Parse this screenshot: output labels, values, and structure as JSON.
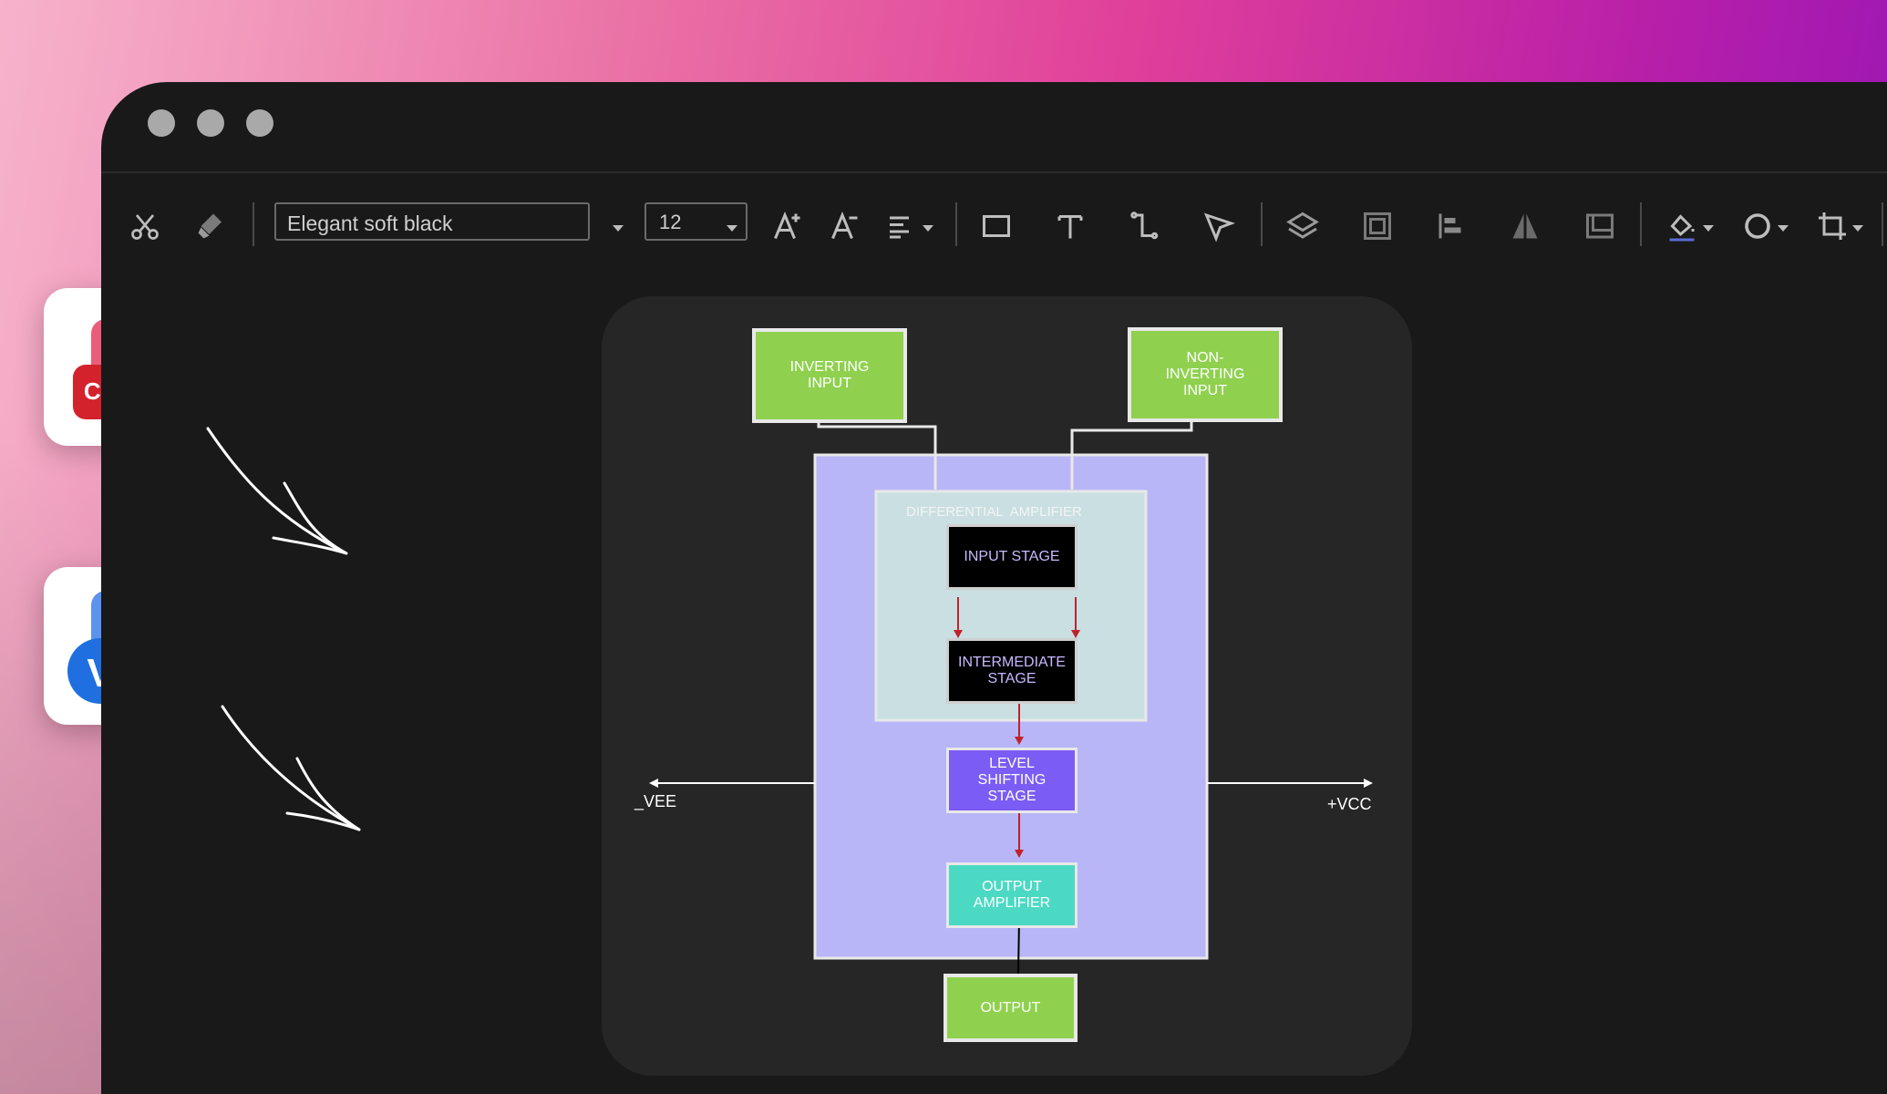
{
  "toolbar": {
    "font_name": "Elegant soft black",
    "font_size": "12"
  },
  "app_icons": {
    "cad_label": "CAD",
    "visio_label": "V"
  },
  "diagram": {
    "inverting_input": "INVERTING INPUT",
    "non_inverting_input": "NON-INVERTING INPUT",
    "differential_amplifier": "DIFFERENTIAL  AMPLIFIER",
    "input_stage": "INPUT STAGE",
    "intermediate_stage": "INTERMEDIATE STAGE",
    "level_shifting_stage": "LEVEL SHIFTING STAGE",
    "output_amplifier": "OUTPUT AMPLIFIER",
    "output": "OUTPUT",
    "vee": "_VEE",
    "vcc": "+VCC"
  },
  "colors": {
    "green_node": "#8fd14f",
    "outer_block": "#b8b6f6",
    "diff_amp_block": "#c9dfe2",
    "level_shift": "#7b5cf5",
    "output_amp": "#4cd9c3",
    "arrow_red": "#c0212b"
  }
}
